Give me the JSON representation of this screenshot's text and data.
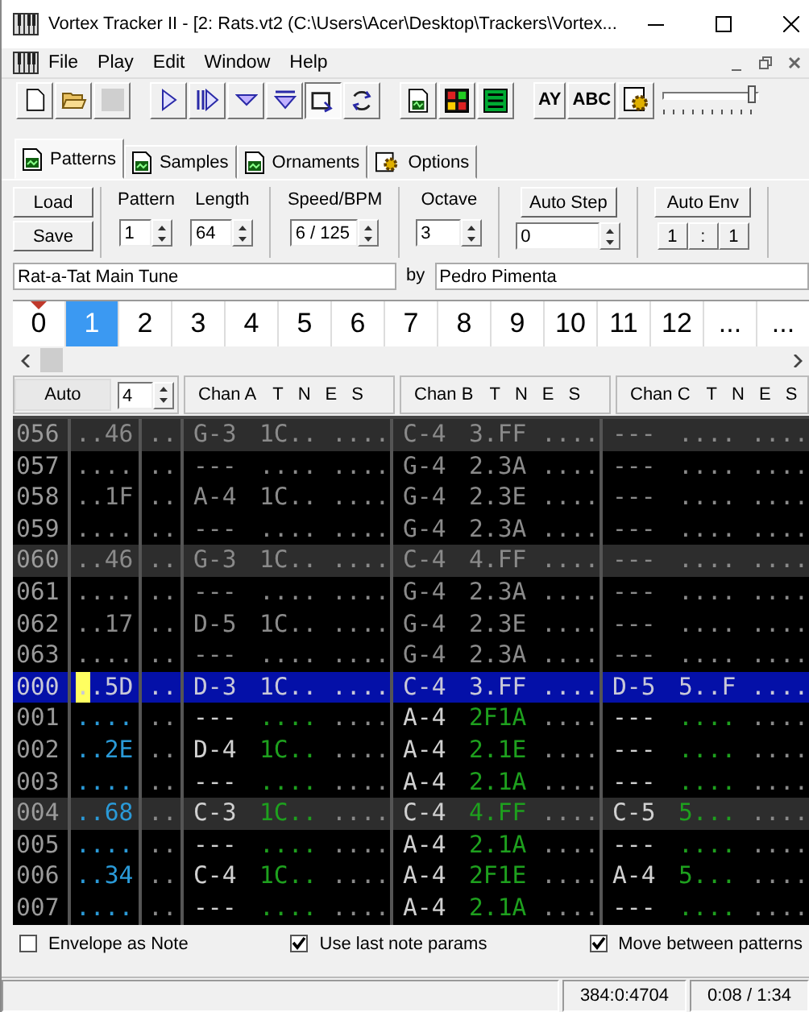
{
  "window": {
    "title": "Vortex Tracker II - [2: Rats.vt2 (C:\\Users\\Acer\\Desktop\\Trackers\\Vortex..."
  },
  "menu": [
    "File",
    "Play",
    "Edit",
    "Window",
    "Help"
  ],
  "toolbar": [
    {
      "kind": "icon",
      "pressed": false,
      "disabled": false
    },
    {
      "kind": "icon",
      "pressed": false,
      "disabled": false
    },
    {
      "kind": "icon",
      "pressed": false,
      "disabled": true
    },
    {
      "kind": "icon",
      "pressed": false,
      "disabled": false
    },
    {
      "kind": "icon",
      "pressed": false,
      "disabled": false
    },
    {
      "kind": "icon",
      "pressed": false,
      "disabled": false
    },
    {
      "kind": "icon",
      "pressed": false,
      "disabled": false
    },
    {
      "kind": "icon",
      "pressed": true,
      "disabled": false
    },
    {
      "kind": "icon",
      "pressed": false,
      "disabled": false
    },
    {
      "kind": "icon",
      "pressed": false,
      "disabled": false
    },
    {
      "kind": "icon",
      "pressed": false,
      "disabled": false
    },
    {
      "kind": "icon",
      "pressed": false,
      "disabled": false
    },
    {
      "kind": "text",
      "label": "AY",
      "pressed": false,
      "disabled": false
    },
    {
      "kind": "text",
      "label": "ABC",
      "pressed": false,
      "disabled": false
    },
    {
      "kind": "icon",
      "pressed": false,
      "disabled": false
    }
  ],
  "volume": {
    "level": 0.93
  },
  "tabs": [
    {
      "label": "Patterns",
      "selected": true
    },
    {
      "label": "Samples",
      "selected": false
    },
    {
      "label": "Ornaments",
      "selected": false
    },
    {
      "label": "Options",
      "selected": false
    }
  ],
  "file_buttons": [
    "Load",
    "Save"
  ],
  "spin_fields": [
    {
      "label": "Pattern",
      "value": "1"
    },
    {
      "label": "Length",
      "value": "64"
    },
    {
      "label": "Speed/BPM",
      "value": "6 / 125"
    },
    {
      "label": "Octave",
      "value": "3"
    }
  ],
  "auto_step": {
    "label": "Auto Step",
    "value": "0"
  },
  "auto_env": {
    "label": "Auto Env",
    "ratio": [
      "1",
      ":",
      "1"
    ]
  },
  "song": {
    "title": "Rat-a-Tat Main Tune",
    "by": "by",
    "author": "Pedro Pimenta"
  },
  "positions": [
    {
      "label": "0",
      "selected": false,
      "marked": true
    },
    {
      "label": "1",
      "selected": true,
      "marked": false
    },
    {
      "label": "2",
      "selected": false,
      "marked": false
    },
    {
      "label": "3",
      "selected": false,
      "marked": false
    },
    {
      "label": "4",
      "selected": false,
      "marked": false
    },
    {
      "label": "5",
      "selected": false,
      "marked": false
    },
    {
      "label": "6",
      "selected": false,
      "marked": false
    },
    {
      "label": "7",
      "selected": false,
      "marked": false
    },
    {
      "label": "8",
      "selected": false,
      "marked": false
    },
    {
      "label": "9",
      "selected": false,
      "marked": false
    },
    {
      "label": "10",
      "selected": false,
      "marked": false
    },
    {
      "label": "11",
      "selected": false,
      "marked": false
    },
    {
      "label": "12",
      "selected": false,
      "marked": false
    },
    {
      "label": "...",
      "selected": false,
      "marked": false
    },
    {
      "label": "...",
      "selected": false,
      "marked": false
    }
  ],
  "pattern_header": {
    "auto": "Auto",
    "step": "4",
    "channels": [
      {
        "name": "Chan A",
        "flags": [
          "T",
          "N",
          "E",
          "S"
        ]
      },
      {
        "name": "Chan B",
        "flags": [
          "T",
          "N",
          "E",
          "S"
        ]
      },
      {
        "name": "Chan C",
        "flags": [
          "T",
          "N",
          "E",
          "S"
        ]
      }
    ]
  },
  "rows": [
    {
      "line": "056",
      "kind": "prev",
      "beat": true,
      "selected": false,
      "cursor": false,
      "cells": [
        "..46",
        "..",
        "G-3",
        "1C..",
        "....",
        "C-4",
        "3.FF",
        "....",
        "---",
        "....",
        "...."
      ]
    },
    {
      "line": "057",
      "kind": "prev",
      "beat": false,
      "selected": false,
      "cursor": false,
      "cells": [
        "....",
        "..",
        "---",
        "....",
        "....",
        "G-4",
        "2.3A",
        "....",
        "---",
        "....",
        "...."
      ]
    },
    {
      "line": "058",
      "kind": "prev",
      "beat": false,
      "selected": false,
      "cursor": false,
      "cells": [
        "..1F",
        "..",
        "A-4",
        "1C..",
        "....",
        "G-4",
        "2.3E",
        "....",
        "---",
        "....",
        "...."
      ]
    },
    {
      "line": "059",
      "kind": "prev",
      "beat": false,
      "selected": false,
      "cursor": false,
      "cells": [
        "....",
        "..",
        "---",
        "....",
        "....",
        "G-4",
        "2.3A",
        "....",
        "---",
        "....",
        "...."
      ]
    },
    {
      "line": "060",
      "kind": "prev",
      "beat": true,
      "selected": false,
      "cursor": false,
      "cells": [
        "..46",
        "..",
        "G-3",
        "1C..",
        "....",
        "C-4",
        "4.FF",
        "....",
        "---",
        "....",
        "...."
      ]
    },
    {
      "line": "061",
      "kind": "prev",
      "beat": false,
      "selected": false,
      "cursor": false,
      "cells": [
        "....",
        "..",
        "---",
        "....",
        "....",
        "G-4",
        "2.3A",
        "....",
        "---",
        "....",
        "...."
      ]
    },
    {
      "line": "062",
      "kind": "prev",
      "beat": false,
      "selected": false,
      "cursor": false,
      "cells": [
        "..17",
        "..",
        "D-5",
        "1C..",
        "....",
        "G-4",
        "2.3E",
        "....",
        "---",
        "....",
        "...."
      ]
    },
    {
      "line": "063",
      "kind": "prev",
      "beat": false,
      "selected": false,
      "cursor": false,
      "cells": [
        "....",
        "..",
        "---",
        "....",
        "....",
        "G-4",
        "2.3A",
        "....",
        "---",
        "....",
        "...."
      ]
    },
    {
      "line": "000",
      "kind": "edit",
      "beat": true,
      "selected": true,
      "cursor": true,
      "cells": [
        "..5D",
        "..",
        "D-3",
        "1C..",
        "....",
        "C-4",
        "3.FF",
        "....",
        "D-5",
        "5..F",
        "...."
      ]
    },
    {
      "line": "001",
      "kind": "edit",
      "beat": false,
      "selected": false,
      "cursor": false,
      "cells": [
        "....",
        "..",
        "---",
        "....",
        "....",
        "A-4",
        "2F1A",
        "....",
        "---",
        "....",
        "...."
      ]
    },
    {
      "line": "002",
      "kind": "edit",
      "beat": false,
      "selected": false,
      "cursor": false,
      "cells": [
        "..2E",
        "..",
        "D-4",
        "1C..",
        "....",
        "A-4",
        "2.1E",
        "....",
        "---",
        "....",
        "...."
      ]
    },
    {
      "line": "003",
      "kind": "edit",
      "beat": false,
      "selected": false,
      "cursor": false,
      "cells": [
        "....",
        "..",
        "---",
        "....",
        "....",
        "A-4",
        "2.1A",
        "....",
        "---",
        "....",
        "...."
      ]
    },
    {
      "line": "004",
      "kind": "edit",
      "beat": true,
      "selected": false,
      "cursor": false,
      "cells": [
        "..68",
        "..",
        "C-3",
        "1C..",
        "....",
        "C-4",
        "4.FF",
        "....",
        "C-5",
        "5...",
        "...."
      ]
    },
    {
      "line": "005",
      "kind": "edit",
      "beat": false,
      "selected": false,
      "cursor": false,
      "cells": [
        "....",
        "..",
        "---",
        "....",
        "....",
        "A-4",
        "2.1A",
        "....",
        "---",
        "....",
        "...."
      ]
    },
    {
      "line": "006",
      "kind": "edit",
      "beat": false,
      "selected": false,
      "cursor": false,
      "cells": [
        "..34",
        "..",
        "C-4",
        "1C..",
        "....",
        "A-4",
        "2F1E",
        "....",
        "A-4",
        "5...",
        "...."
      ]
    },
    {
      "line": "007",
      "kind": "edit",
      "beat": false,
      "selected": false,
      "cursor": false,
      "cells": [
        "....",
        "..",
        "---",
        "....",
        "....",
        "A-4",
        "2.1A",
        "....",
        "---",
        "....",
        "...."
      ]
    }
  ],
  "options": [
    {
      "label": "Envelope as Note",
      "checked": false
    },
    {
      "label": "Use last note params",
      "checked": true
    },
    {
      "label": "Move between patterns",
      "checked": true
    }
  ],
  "status_bar": [
    "384:0:4704",
    "0:08 / 1:34"
  ]
}
